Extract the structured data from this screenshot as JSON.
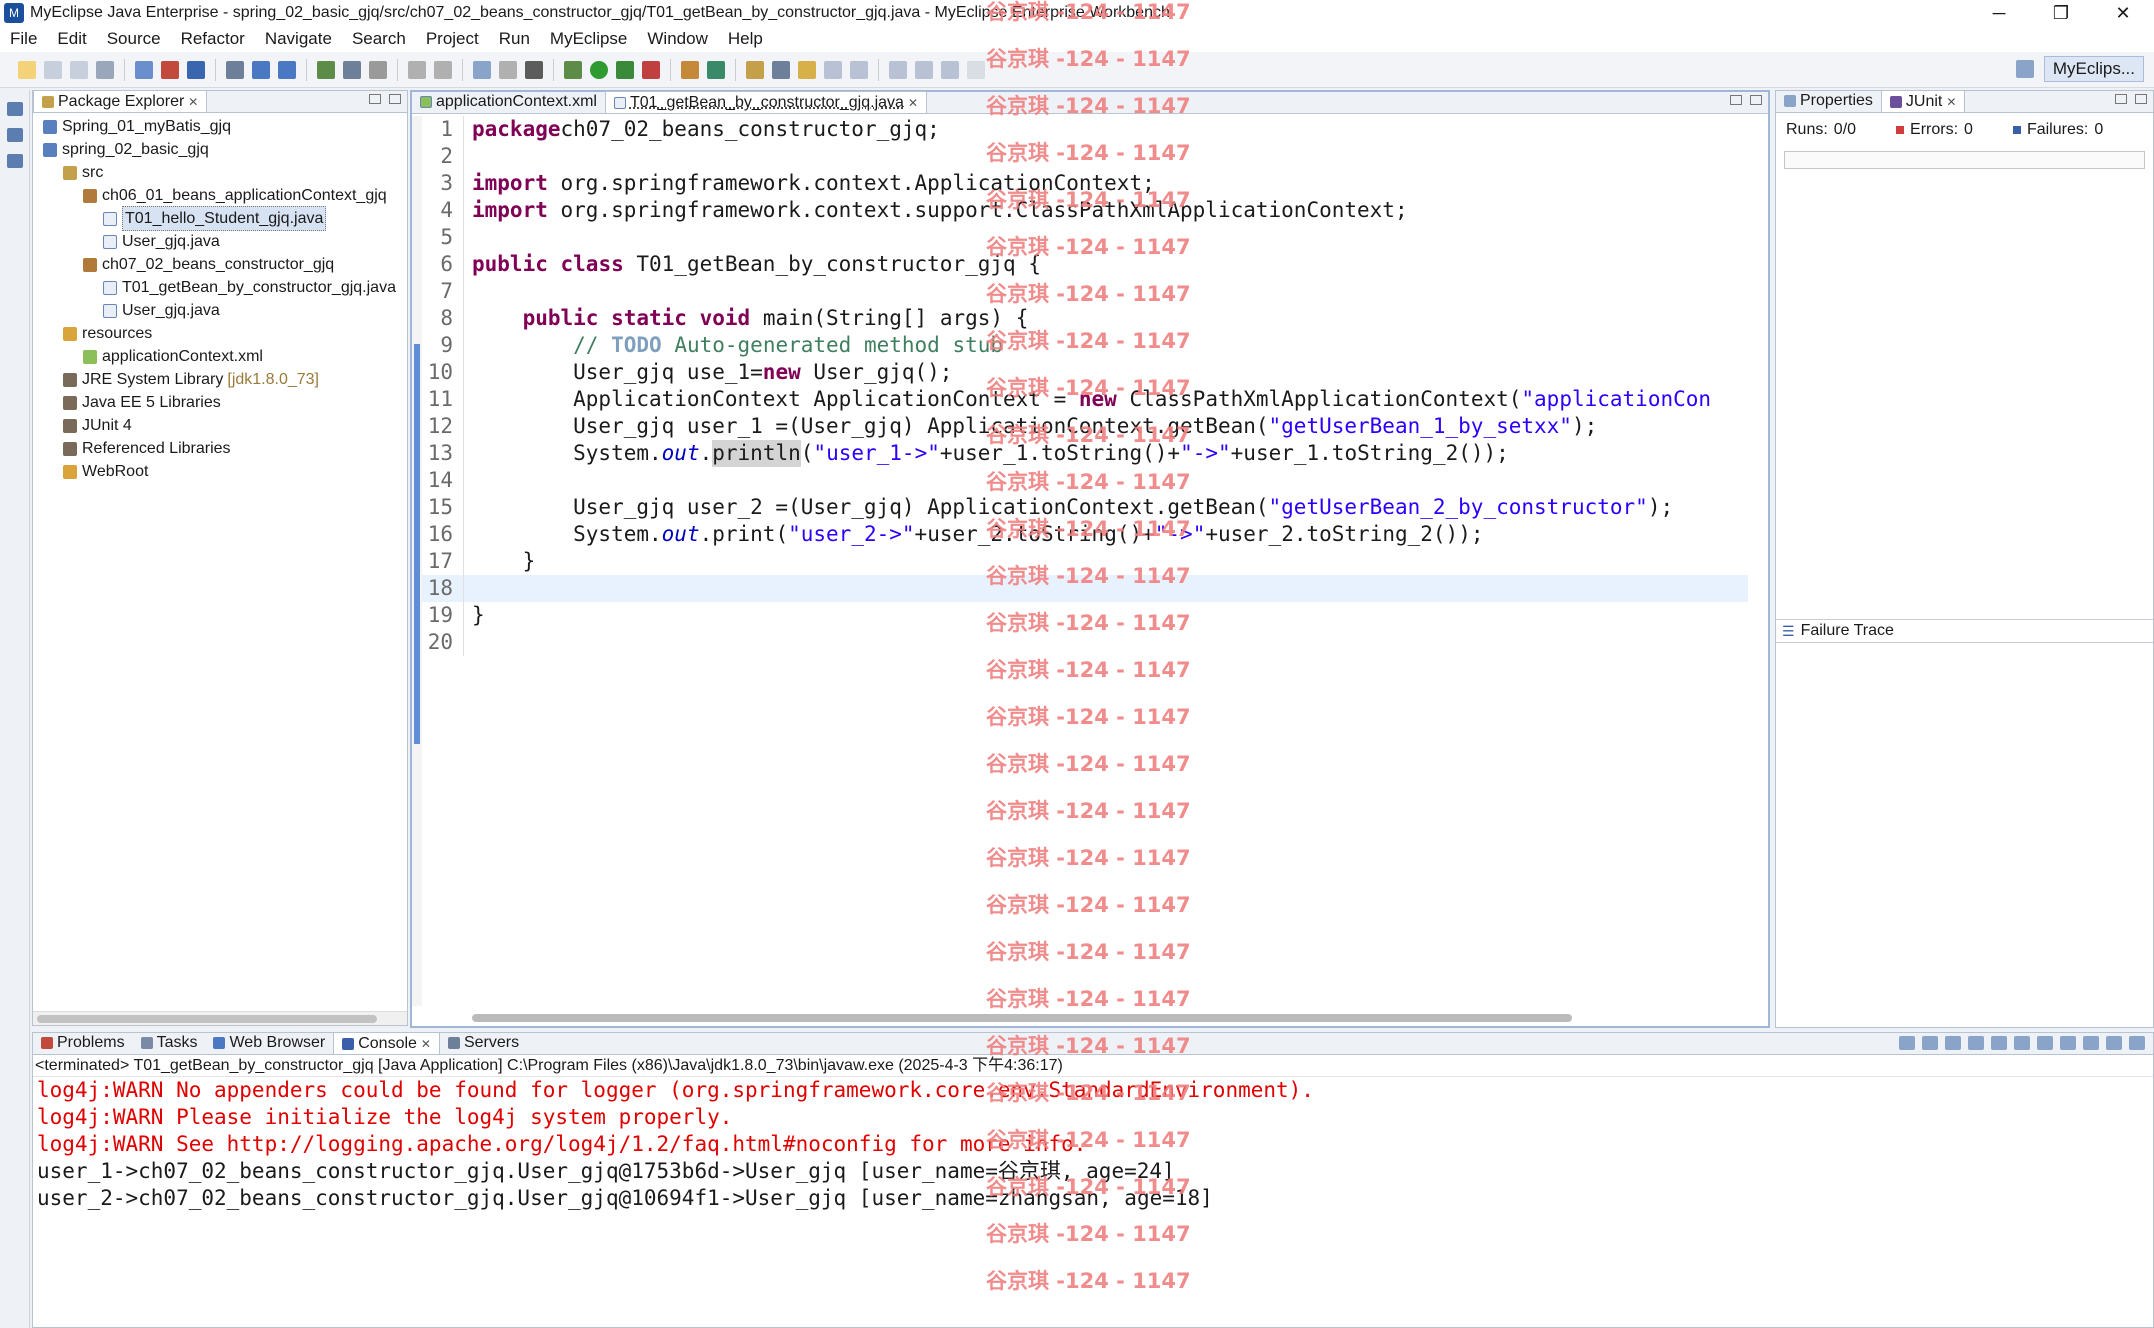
{
  "window": {
    "title": "MyEclipse Java Enterprise - spring_02_basic_gjq/src/ch07_02_beans_constructor_gjq/T01_getBean_by_constructor_gjq.java - MyEclipse Enterprise Workbench",
    "minimize": "─",
    "restore": "❐",
    "close": "✕"
  },
  "menu": [
    "File",
    "Edit",
    "Source",
    "Refactor",
    "Navigate",
    "Search",
    "Project",
    "Run",
    "MyEclipse",
    "Window",
    "Help"
  ],
  "perspective": {
    "label": "MyEclips..."
  },
  "package_explorer": {
    "tab": "Package Explorer",
    "tree": [
      {
        "label": "Spring_01_myBatis_gjq",
        "indent": 0,
        "icon": "project-icon"
      },
      {
        "label": "spring_02_basic_gjq",
        "indent": 0,
        "icon": "project-icon"
      },
      {
        "label": "src",
        "indent": 1,
        "icon": "source-folder-icon"
      },
      {
        "label": "ch06_01_beans_applicationContext_gjq",
        "indent": 2,
        "icon": "package-icon"
      },
      {
        "label": "T01_hello_Student_gjq.java",
        "indent": 3,
        "icon": "java-file-icon",
        "selected": true
      },
      {
        "label": "User_gjq.java",
        "indent": 3,
        "icon": "java-file-icon"
      },
      {
        "label": "ch07_02_beans_constructor_gjq",
        "indent": 2,
        "icon": "package-icon"
      },
      {
        "label": "T01_getBean_by_constructor_gjq.java",
        "indent": 3,
        "icon": "java-file-icon"
      },
      {
        "label": "User_gjq.java",
        "indent": 3,
        "icon": "java-file-icon"
      },
      {
        "label": "resources",
        "indent": 1,
        "icon": "folder-icon"
      },
      {
        "label": "applicationContext.xml",
        "indent": 2,
        "icon": "xml-file-icon"
      },
      {
        "label": "JRE System Library",
        "indent": 1,
        "icon": "library-icon",
        "extra": "[jdk1.8.0_73]"
      },
      {
        "label": "Java EE 5 Libraries",
        "indent": 1,
        "icon": "library-icon"
      },
      {
        "label": "JUnit 4",
        "indent": 1,
        "icon": "library-icon"
      },
      {
        "label": "Referenced Libraries",
        "indent": 1,
        "icon": "library-icon"
      },
      {
        "label": "WebRoot",
        "indent": 1,
        "icon": "folder-icon"
      }
    ]
  },
  "editor": {
    "tabs": [
      {
        "label": "applicationContext.xml",
        "active": false
      },
      {
        "label": "T01_getBean_by_constructor_gjq.java",
        "active": true
      }
    ],
    "current_line": 18,
    "lines": [
      {
        "n": "1",
        "parts": [
          [
            "kw",
            "package"
          ],
          [
            "",
            "ch07_02_beans_constructor_gjq;"
          ]
        ]
      },
      {
        "n": "2",
        "parts": []
      },
      {
        "n": "3",
        "parts": [
          [
            "kw",
            "import"
          ],
          [
            "",
            " org.springframework.context.ApplicationContext;"
          ]
        ]
      },
      {
        "n": "4",
        "parts": [
          [
            "kw",
            "import"
          ],
          [
            "",
            " org.springframework.context.support.ClassPathXmlApplicationContext;"
          ]
        ]
      },
      {
        "n": "5",
        "parts": []
      },
      {
        "n": "6",
        "parts": [
          [
            "kw",
            "public"
          ],
          [
            "",
            " "
          ],
          [
            "kw",
            "class"
          ],
          [
            "",
            " T01_getBean_by_constructor_gjq {"
          ]
        ]
      },
      {
        "n": "7",
        "parts": []
      },
      {
        "n": "8",
        "parts": [
          [
            "",
            "    "
          ],
          [
            "kw",
            "public"
          ],
          [
            "",
            " "
          ],
          [
            "kw",
            "static"
          ],
          [
            "",
            " "
          ],
          [
            "kw",
            "void"
          ],
          [
            "",
            " main(String[] args) {"
          ]
        ]
      },
      {
        "n": "9",
        "parts": [
          [
            "",
            "        "
          ],
          [
            "cm",
            "// "
          ],
          [
            "todo",
            "TODO"
          ],
          [
            "cm",
            " Auto-generated method stub"
          ]
        ]
      },
      {
        "n": "10",
        "parts": [
          [
            "",
            "        User_gjq use_1="
          ],
          [
            "kw",
            "new"
          ],
          [
            "",
            " User_gjq();"
          ]
        ]
      },
      {
        "n": "11",
        "parts": [
          [
            "",
            "        ApplicationContext ApplicationContext = "
          ],
          [
            "kw",
            "new"
          ],
          [
            "",
            " ClassPathXmlApplicationContext("
          ],
          [
            "str",
            "\"applicationCon"
          ]
        ]
      },
      {
        "n": "12",
        "parts": [
          [
            "",
            "        User_gjq user_1 =(User_gjq) ApplicationContext.getBean("
          ],
          [
            "str",
            "\"getUserBean_1_by_setxx\""
          ],
          [
            "",
            ");"
          ]
        ]
      },
      {
        "n": "13",
        "parts": [
          [
            "",
            "        System."
          ],
          [
            "it",
            "out"
          ],
          [
            "",
            "."
          ],
          [
            "hl",
            "println"
          ],
          [
            "",
            "("
          ],
          [
            "str",
            "\"user_1->\""
          ],
          [
            "",
            "+user_1.toString()+"
          ],
          [
            "str",
            "\"->\""
          ],
          [
            "",
            "+user_1.toString_2());"
          ]
        ]
      },
      {
        "n": "14",
        "parts": []
      },
      {
        "n": "15",
        "parts": [
          [
            "",
            "        User_gjq user_2 =(User_gjq) ApplicationContext.getBean("
          ],
          [
            "str",
            "\"getUserBean_2_by_constructor\""
          ],
          [
            "",
            ");"
          ]
        ]
      },
      {
        "n": "16",
        "parts": [
          [
            "",
            "        System."
          ],
          [
            "it",
            "out"
          ],
          [
            "",
            ".print("
          ],
          [
            "str",
            "\"user_2->\""
          ],
          [
            "",
            "+user_2.toString()+"
          ],
          [
            "str",
            "\"->\""
          ],
          [
            "",
            "+user_2.toString_2());"
          ]
        ]
      },
      {
        "n": "17",
        "parts": [
          [
            "",
            "    }"
          ]
        ]
      },
      {
        "n": "18",
        "parts": []
      },
      {
        "n": "19",
        "parts": [
          [
            "",
            "}"
          ]
        ]
      },
      {
        "n": "20",
        "parts": []
      }
    ]
  },
  "junit": {
    "tabs": [
      {
        "label": "Properties"
      },
      {
        "label": "JUnit"
      }
    ],
    "runs_label": "Runs:",
    "runs_value": "0/0",
    "errors_label": "Errors:",
    "errors_value": "0",
    "failures_label": "Failures:",
    "failures_value": "0",
    "failure_trace": "Failure Trace"
  },
  "console": {
    "tabs": [
      "Problems",
      "Tasks",
      "Web Browser",
      "Console",
      "Servers"
    ],
    "status": "<terminated> T01_getBean_by_constructor_gjq [Java Application] C:\\Program Files (x86)\\Java\\jdk1.8.0_73\\bin\\javaw.exe (2025-4-3 下午4:36:17)",
    "lines": [
      {
        "text": "log4j:WARN No appenders could be found for logger (org.springframework.core.env.StandardEnvironment).",
        "error": true
      },
      {
        "text": "log4j:WARN Please initialize the log4j system properly.",
        "error": true
      },
      {
        "text": "log4j:WARN See http://logging.apache.org/log4j/1.2/faq.html#noconfig for more info.",
        "error": true
      },
      {
        "text": "user_1->ch07_02_beans_constructor_gjq.User_gjq@1753b6d->User_gjq [user_name=谷京琪, age=24]",
        "error": false
      },
      {
        "text": "user_2->ch07_02_beans_constructor_gjq.User_gjq@10694f1->User_gjq [user_name=zhangsan, age=18]",
        "error": false
      }
    ]
  },
  "watermark": "谷京琪 -124 - 1147",
  "colors": {
    "keyword": "#7f0055",
    "string": "#2a00ff",
    "comment": "#3f7f5f",
    "error": "#e00000",
    "watermark": "#f08080"
  }
}
